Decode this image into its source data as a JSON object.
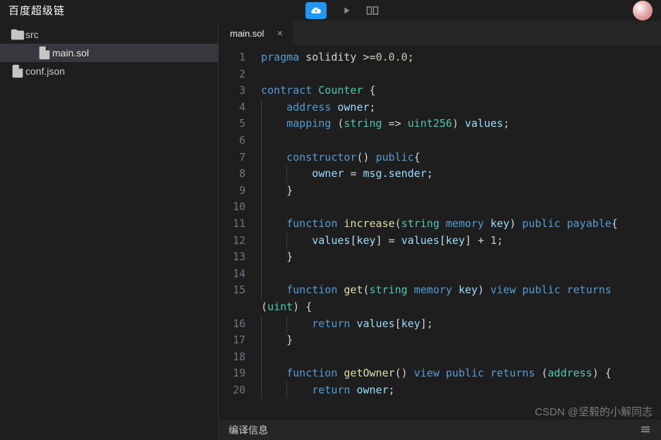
{
  "header": {
    "brand": "百度超级链"
  },
  "sidebar": {
    "items": [
      {
        "name": "src",
        "type": "folder",
        "indent": 0,
        "selected": false
      },
      {
        "name": "main.sol",
        "type": "file",
        "indent": 1,
        "selected": true
      },
      {
        "name": "conf.json",
        "type": "file",
        "indent": 0,
        "selected": false
      }
    ]
  },
  "tabs": [
    {
      "label": "main.sol",
      "active": true
    }
  ],
  "editor": {
    "lineStart": 1,
    "lineEnd": 20,
    "lines": [
      [
        [
          "kw",
          "pragma"
        ],
        [
          "",
          ""
        ],
        [
          "",
          "solidity"
        ],
        [
          "",
          ""
        ],
        [
          "punc",
          ">="
        ],
        [
          "num",
          "0.0.0"
        ],
        [
          "punc",
          ";"
        ]
      ],
      [],
      [
        [
          "kw",
          "contract"
        ],
        [
          "",
          ""
        ],
        [
          "type",
          "Counter"
        ],
        [
          "",
          ""
        ],
        [
          "punc",
          "{"
        ]
      ],
      [
        [
          "indent",
          1
        ],
        [
          "kw",
          "address"
        ],
        [
          "",
          ""
        ],
        [
          "id",
          "owner"
        ],
        [
          "punc",
          ";"
        ]
      ],
      [
        [
          "indent",
          1
        ],
        [
          "kw",
          "mapping"
        ],
        [
          "",
          ""
        ],
        [
          "punc",
          "("
        ],
        [
          "type",
          "string"
        ],
        [
          "",
          ""
        ],
        [
          "punc",
          "=>"
        ],
        [
          "",
          ""
        ],
        [
          "type",
          "uint256"
        ],
        [
          "punc",
          ")"
        ],
        [
          "",
          ""
        ],
        [
          "id",
          "values"
        ],
        [
          "punc",
          ";"
        ]
      ],
      [
        [
          "indent",
          1
        ]
      ],
      [
        [
          "indent",
          1
        ],
        [
          "kw",
          "constructor"
        ],
        [
          "punc",
          "()"
        ],
        [
          "",
          ""
        ],
        [
          "kw",
          "public"
        ],
        [
          "punc",
          "{"
        ]
      ],
      [
        [
          "indent",
          2
        ],
        [
          "id",
          "owner"
        ],
        [
          "",
          ""
        ],
        [
          "punc",
          "="
        ],
        [
          "",
          ""
        ],
        [
          "id",
          "msg"
        ],
        [
          "punc",
          "."
        ],
        [
          "id",
          "sender"
        ],
        [
          "punc",
          ";"
        ]
      ],
      [
        [
          "indent",
          1
        ],
        [
          "punc",
          "}"
        ]
      ],
      [
        [
          "indent",
          1
        ]
      ],
      [
        [
          "indent",
          1
        ],
        [
          "kw",
          "function"
        ],
        [
          "",
          ""
        ],
        [
          "fn",
          "increase"
        ],
        [
          "punc",
          "("
        ],
        [
          "type",
          "string"
        ],
        [
          "",
          ""
        ],
        [
          "kw",
          "memory"
        ],
        [
          "",
          ""
        ],
        [
          "id",
          "key"
        ],
        [
          "punc",
          ")"
        ],
        [
          "",
          ""
        ],
        [
          "kw",
          "public"
        ],
        [
          "",
          ""
        ],
        [
          "kw",
          "payable"
        ],
        [
          "punc",
          "{"
        ]
      ],
      [
        [
          "indent",
          2
        ],
        [
          "id",
          "values"
        ],
        [
          "punc",
          "["
        ],
        [
          "id",
          "key"
        ],
        [
          "punc",
          "]"
        ],
        [
          "",
          ""
        ],
        [
          "punc",
          "="
        ],
        [
          "",
          ""
        ],
        [
          "id",
          "values"
        ],
        [
          "punc",
          "["
        ],
        [
          "id",
          "key"
        ],
        [
          "punc",
          "]"
        ],
        [
          "",
          ""
        ],
        [
          "punc",
          "+"
        ],
        [
          "",
          ""
        ],
        [
          "num",
          "1"
        ],
        [
          "punc",
          ";"
        ]
      ],
      [
        [
          "indent",
          1
        ],
        [
          "punc",
          "}"
        ]
      ],
      [
        [
          "indent",
          1
        ]
      ],
      [
        [
          "indent",
          1
        ],
        [
          "kw",
          "function"
        ],
        [
          "",
          ""
        ],
        [
          "fn",
          "get"
        ],
        [
          "punc",
          "("
        ],
        [
          "type",
          "string"
        ],
        [
          "",
          ""
        ],
        [
          "kw",
          "memory"
        ],
        [
          "",
          ""
        ],
        [
          "id",
          "key"
        ],
        [
          "punc",
          ")"
        ],
        [
          "",
          ""
        ],
        [
          "kw",
          "view"
        ],
        [
          "",
          ""
        ],
        [
          "kw",
          "public"
        ],
        [
          "",
          ""
        ],
        [
          "kw",
          "returns"
        ],
        [
          "",
          ""
        ],
        [
          "punc",
          "("
        ],
        [
          "type",
          "uint"
        ],
        [
          "punc",
          ")"
        ],
        [
          "",
          ""
        ],
        [
          "punc",
          "{"
        ]
      ],
      [
        [
          "indent",
          2
        ],
        [
          "kw",
          "return"
        ],
        [
          "",
          ""
        ],
        [
          "id",
          "values"
        ],
        [
          "punc",
          "["
        ],
        [
          "id",
          "key"
        ],
        [
          "punc",
          "];"
        ]
      ],
      [
        [
          "indent",
          1
        ],
        [
          "punc",
          "}"
        ]
      ],
      [
        [
          "indent",
          1
        ]
      ],
      [
        [
          "indent",
          1
        ],
        [
          "kw",
          "function"
        ],
        [
          "",
          ""
        ],
        [
          "fn",
          "getOwner"
        ],
        [
          "punc",
          "()"
        ],
        [
          "",
          ""
        ],
        [
          "kw",
          "view"
        ],
        [
          "",
          ""
        ],
        [
          "kw",
          "public"
        ],
        [
          "",
          ""
        ],
        [
          "kw",
          "returns"
        ],
        [
          "",
          ""
        ],
        [
          "punc",
          "("
        ],
        [
          "type",
          "address"
        ],
        [
          "punc",
          ")"
        ],
        [
          "",
          ""
        ],
        [
          "punc",
          "{"
        ]
      ],
      [
        [
          "indent",
          2
        ],
        [
          "kw",
          "return"
        ],
        [
          "",
          ""
        ],
        [
          "id",
          "owner"
        ],
        [
          "punc",
          ";"
        ]
      ]
    ],
    "wrapLineIndex": 14
  },
  "bottom": {
    "compileInfo": "编译信息"
  },
  "watermark": "CSDN @坚毅的小解同志"
}
